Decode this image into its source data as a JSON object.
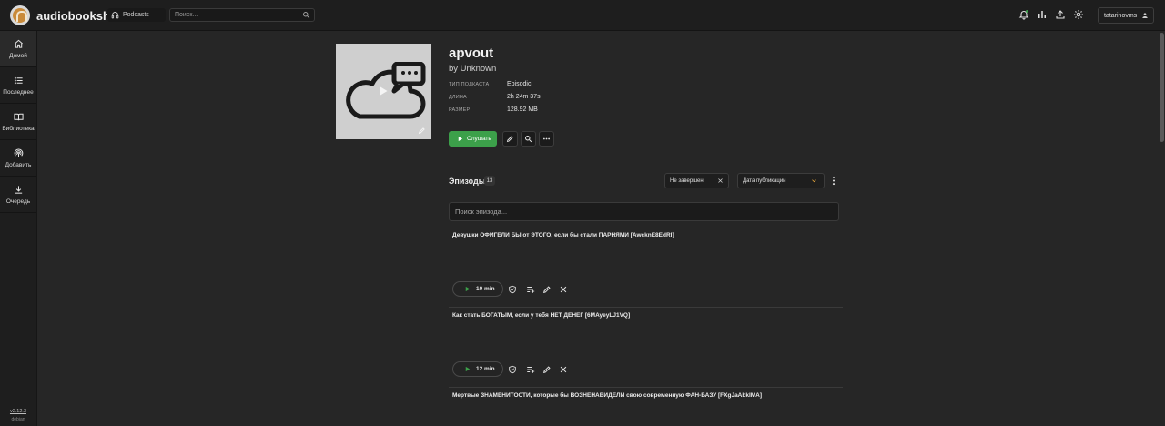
{
  "header": {
    "app_title": "audiobookshelf",
    "library": {
      "name": "Podcasts",
      "icon": "headphones-icon"
    },
    "search_placeholder": "Поиск...",
    "icons": [
      "bell-icon",
      "stats-icon",
      "upload-icon",
      "settings-icon"
    ],
    "user": "tatarinovms"
  },
  "sidebar": {
    "items": [
      {
        "label": "Домой",
        "icon": "home-icon",
        "active": true
      },
      {
        "label": "Последнее",
        "icon": "list-icon",
        "active": false
      },
      {
        "label": "Библиотека",
        "icon": "book-icon",
        "active": false
      },
      {
        "label": "Добавить",
        "icon": "podcast-icon",
        "active": false
      },
      {
        "label": "Очередь",
        "icon": "download-icon",
        "active": false
      }
    ],
    "version": "v2.12.3",
    "build": "debian"
  },
  "podcast": {
    "title": "apvout",
    "author": "by Unknown",
    "meta": [
      {
        "label": "ТИП ПОДКАСТА",
        "value": "Episodic"
      },
      {
        "label": "ДЛИНА",
        "value": "2h 24m 37s"
      },
      {
        "label": "РАЗМЕР",
        "value": "128.92 MB"
      }
    ],
    "listen_label": "Слушать"
  },
  "episodes": {
    "label": "Эпизоды",
    "count": "13",
    "filter": "Не завершен",
    "sort": "Дата публикации",
    "search_placeholder": "Поиск эпизода...",
    "items": [
      {
        "title": "Девушки ОФИГЕЛИ БЫ от ЭТОГО, если бы стали ПАРНЯМИ [AwcknE8EdRI]",
        "duration": "10 min"
      },
      {
        "title": "Как стать БОГАТЫМ, если у тебя НЕТ ДЕНЕГ [6MAyeyLJ1VQ]",
        "duration": "12 min"
      },
      {
        "title": "Мертвые ЗНАМЕНИТОСТИ, которые бы ВОЗНЕНАВИДЕЛИ свою современную ФАН-БАЗУ [FXgJaAbkIMA]",
        "duration": ""
      }
    ]
  },
  "colors": {
    "accent_green": "#3ca04a",
    "background": "#262626",
    "bar": "#1e1e1e"
  }
}
